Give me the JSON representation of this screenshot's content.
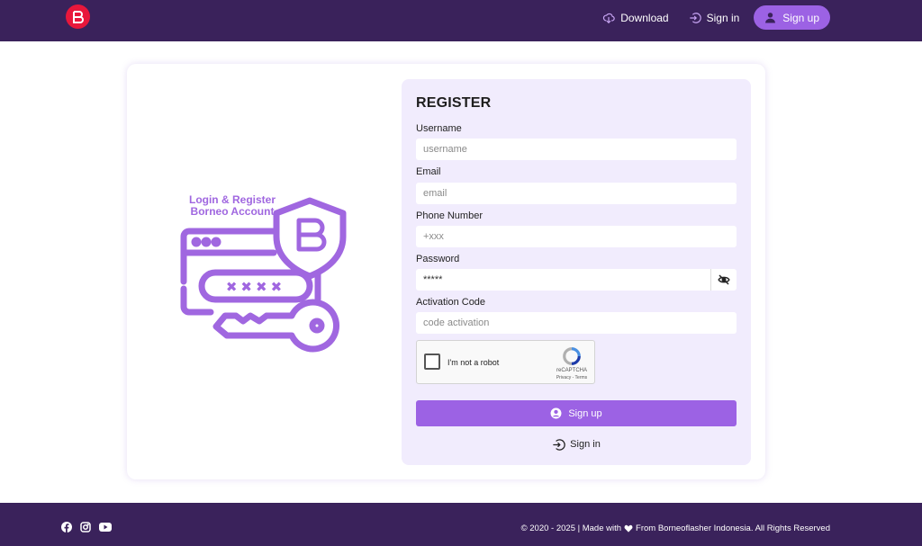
{
  "header": {
    "logo_icon": "borneo-b-logo-icon",
    "nav": {
      "download_label": "Download",
      "signin_label": "Sign in",
      "signup_label": "Sign up"
    }
  },
  "illustration": {
    "title_line1": "Login & Register",
    "title_line2": "Borneo Account",
    "password_mask": "✖✖✖✖"
  },
  "form": {
    "title": "REGISTER",
    "fields": [
      {
        "label": "Username",
        "placeholder": "username"
      },
      {
        "label": "Email",
        "placeholder": "email"
      },
      {
        "label": "Phone Number",
        "placeholder": "+xxx"
      },
      {
        "label": "Password",
        "value": "*****"
      },
      {
        "label": "Activation Code",
        "placeholder": "code activation"
      }
    ],
    "password_toggle_icon": "eye-slash-icon",
    "captcha": {
      "label": "I'm not a robot",
      "brand": "reCAPTCHA",
      "terms": "Privacy - Terms"
    },
    "signup_label": "Sign up",
    "signin_label": "Sign in"
  },
  "footer": {
    "socials": [
      "facebook-icon",
      "instagram-icon",
      "youtube-icon"
    ],
    "copyright_prefix": "© 2020 - 2025 | Made with",
    "copyright_suffix": "From Borneoflasher Indonesia. All Rights Reserved"
  },
  "colors": {
    "header_bg": "#3a225b",
    "accent": "#9c62e4",
    "logo_red": "#e8173b",
    "panel_bg": "#f1ecfd",
    "illustration": "#a067e0"
  }
}
